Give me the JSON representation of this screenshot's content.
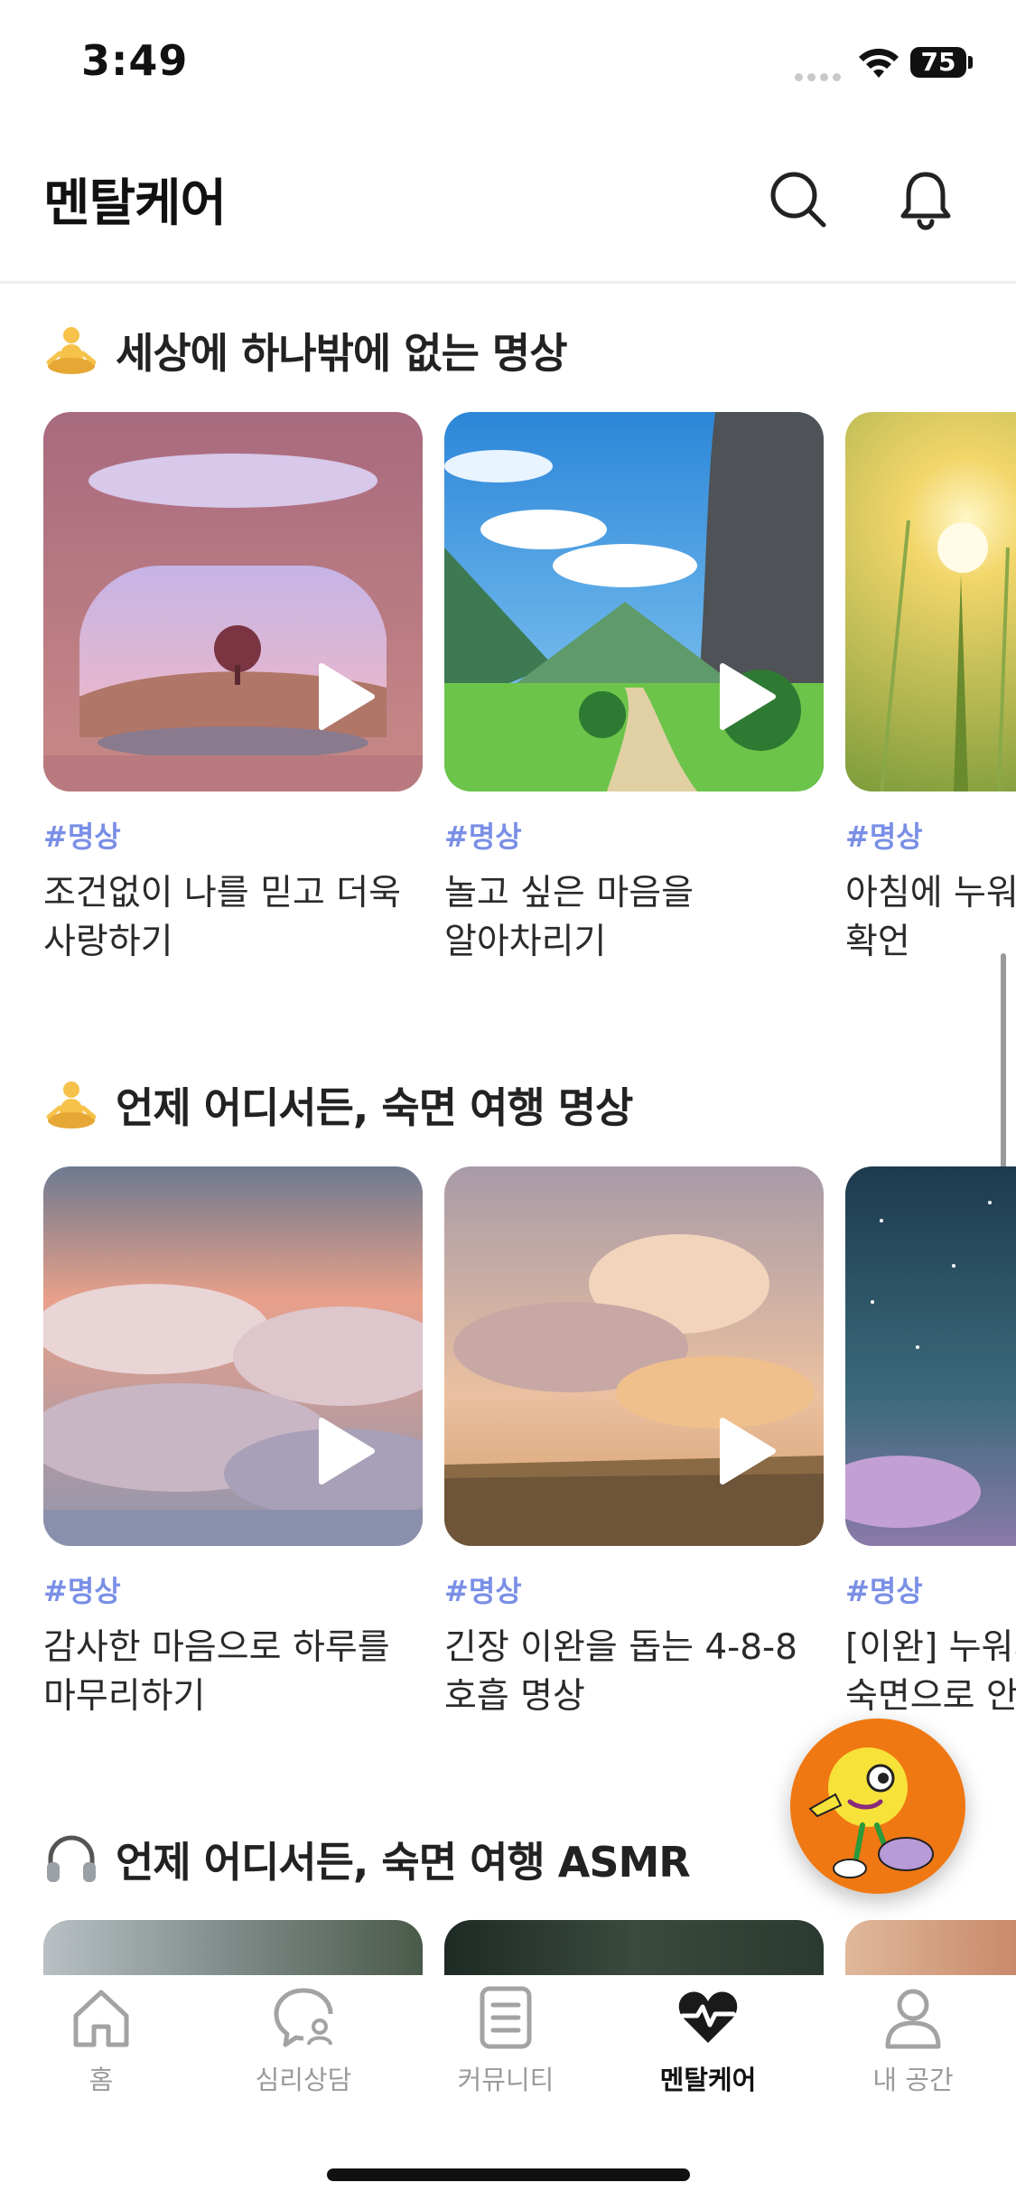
{
  "status_bar": {
    "time": "3:49",
    "battery": "75"
  },
  "header": {
    "title": "멘탈케어",
    "search_icon": "search-icon",
    "bell_icon": "bell-icon"
  },
  "sections": [
    {
      "icon": "meditation-emoji",
      "title": "세상에 하나밖에 없는 명상",
      "cards": [
        {
          "tag": "#명상",
          "title_line1": "조건없이 나를 믿고 더욱",
          "title_line2": "사랑하기",
          "image": "pink-room-tree"
        },
        {
          "tag": "#명상",
          "title_line1": "놀고 싶은 마음을",
          "title_line2": "알아차리기",
          "image": "green-valley"
        },
        {
          "tag": "#명상",
          "title_line1": "아침에 누워",
          "title_line2": "확언",
          "image": "wheat-sunrise"
        }
      ]
    },
    {
      "icon": "meditation-emoji",
      "title": "언제 어디서든, 숙면 여행 명상",
      "cards": [
        {
          "tag": "#명상",
          "title_line1": "감사한 마음으로 하루를",
          "title_line2": "마무리하기",
          "image": "clouds-dusk"
        },
        {
          "tag": "#명상",
          "title_line1": "긴장 이완을 돕는 4-8-8",
          "title_line2": "호흡 명상",
          "image": "clouds-field"
        },
        {
          "tag": "#명상",
          "title_line1": "[이완] 누워서",
          "title_line2": "숙면으로 안",
          "image": "starry-sky"
        }
      ]
    },
    {
      "icon": "headphones-emoji",
      "title": "언제 어디서든, 숙면 여행 ASMR"
    }
  ],
  "tabbar": {
    "items": [
      {
        "label": "홈",
        "icon": "home-icon",
        "active": false
      },
      {
        "label": "심리상담",
        "icon": "chat-counsel-icon",
        "active": false
      },
      {
        "label": "커뮤니티",
        "icon": "document-icon",
        "active": false
      },
      {
        "label": "멘탈케어",
        "icon": "heart-pulse-icon",
        "active": true
      },
      {
        "label": "내 공간",
        "icon": "person-icon",
        "active": false
      }
    ]
  },
  "colors": {
    "tag": "#7a8fe6",
    "fab": "#f07812",
    "text": "#1f1f1f"
  }
}
